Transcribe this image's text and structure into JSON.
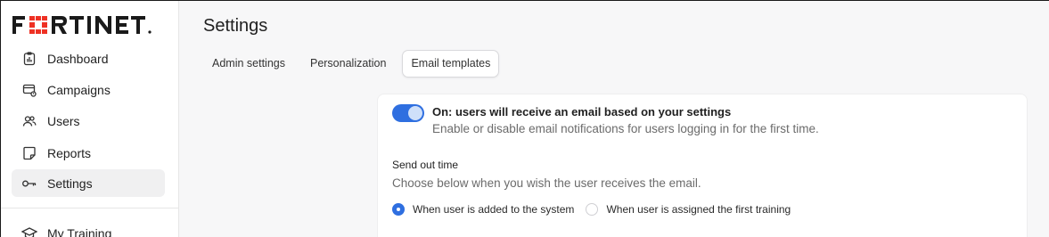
{
  "brand": {
    "logo_text": "FORTINET",
    "accent": "#ee3124"
  },
  "sidebar": {
    "items": [
      {
        "label": "Dashboard",
        "icon": "dashboard-icon"
      },
      {
        "label": "Campaigns",
        "icon": "campaigns-icon"
      },
      {
        "label": "Users",
        "icon": "users-icon"
      },
      {
        "label": "Reports",
        "icon": "reports-icon"
      },
      {
        "label": "Settings",
        "icon": "key-icon",
        "active": true
      },
      {
        "label": "My Training",
        "icon": "graduation-cap-icon"
      }
    ]
  },
  "main": {
    "title": "Settings",
    "tabs": [
      {
        "label": "Admin settings"
      },
      {
        "label": "Personalization"
      },
      {
        "label": "Email templates",
        "active": true
      }
    ]
  },
  "card": {
    "toggle": {
      "on": true,
      "title": "On: users will receive an email based on your settings",
      "description": "Enable or disable email notifications for users logging in for the first time."
    },
    "send_out": {
      "label": "Send out time",
      "description": "Choose below when you wish the user receives the email.",
      "options": [
        {
          "label": "When user is added to the system",
          "checked": true
        },
        {
          "label": "When user is assigned the first training",
          "checked": false
        }
      ]
    }
  },
  "colors": {
    "primary": "#2f6fe0",
    "text_muted": "#6b6b6b",
    "active_nav_bg": "#f0f0f1"
  }
}
